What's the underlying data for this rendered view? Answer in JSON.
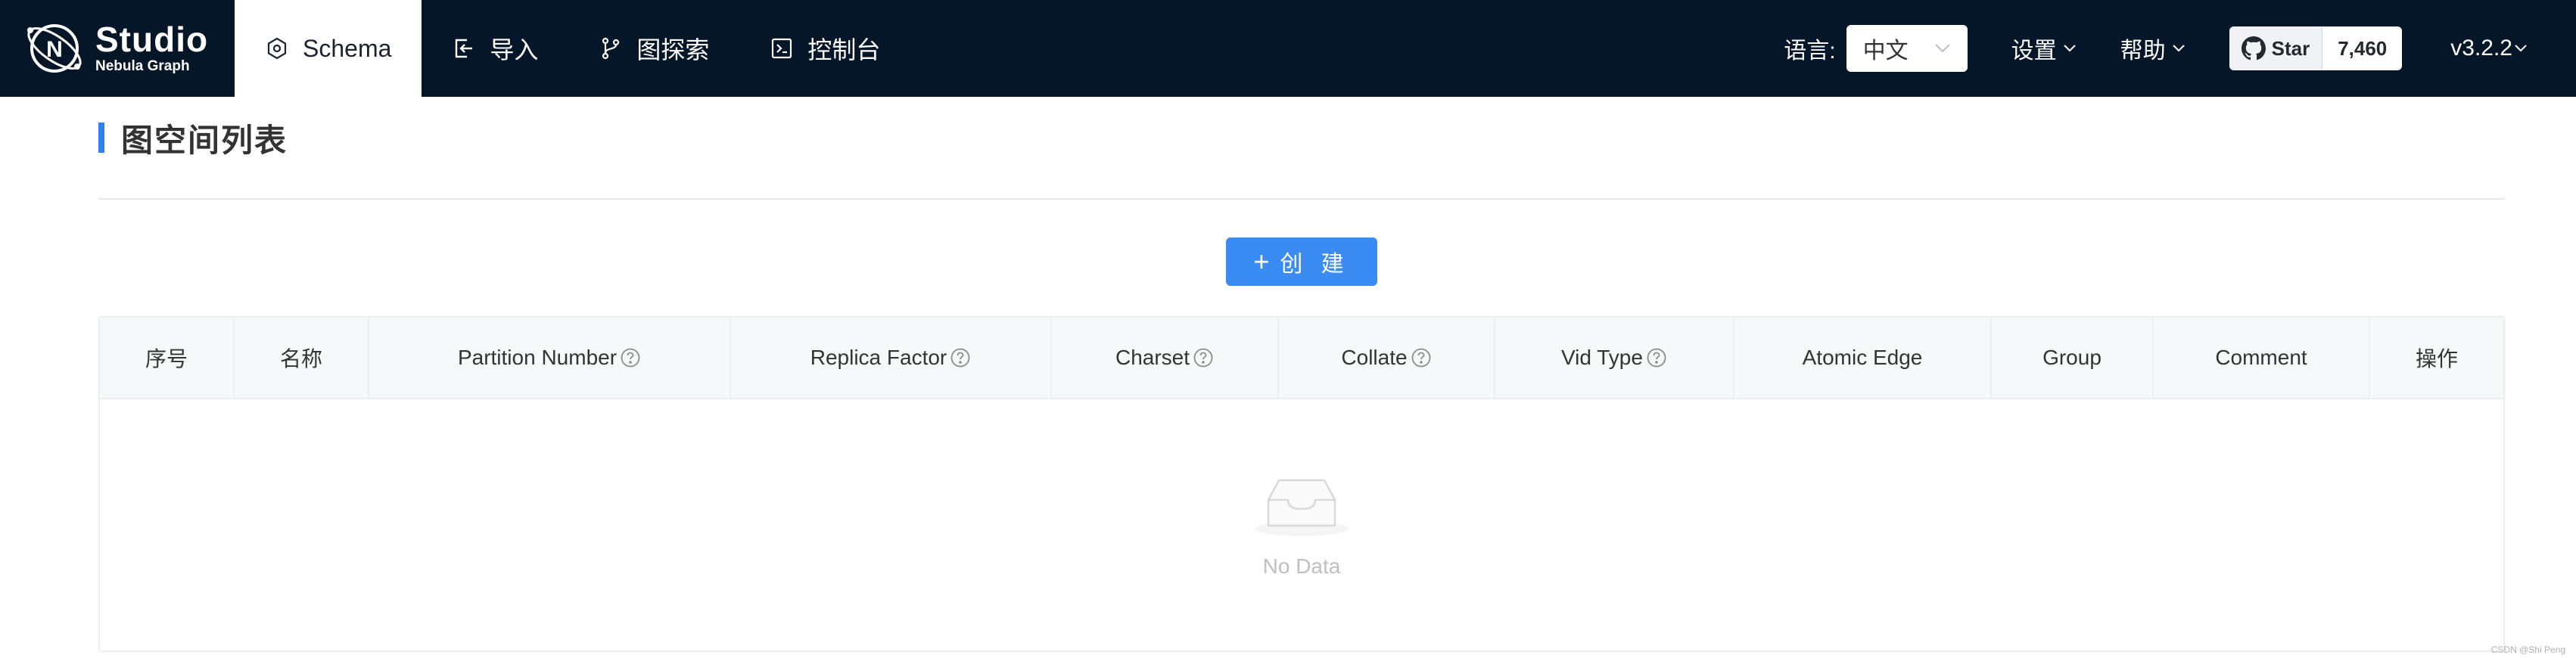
{
  "brand": {
    "title": "Studio",
    "subtitle": "Nebula Graph",
    "logo_letter": "N"
  },
  "nav": {
    "items": [
      {
        "label": "Schema",
        "icon": "schema-icon",
        "active": true
      },
      {
        "label": "导入",
        "icon": "import-icon",
        "active": false
      },
      {
        "label": "图探索",
        "icon": "explore-icon",
        "active": false
      },
      {
        "label": "控制台",
        "icon": "console-icon",
        "active": false
      }
    ]
  },
  "header": {
    "language_label": "语言:",
    "language_value": "中文",
    "settings_label": "设置",
    "help_label": "帮助",
    "github_star_label": "Star",
    "github_star_count": "7,460",
    "version": "v3.2.2"
  },
  "page": {
    "title": "图空间列表",
    "create_button": "创 建"
  },
  "table": {
    "columns": [
      {
        "label": "序号",
        "help": false
      },
      {
        "label": "名称",
        "help": false
      },
      {
        "label": "Partition Number",
        "help": true
      },
      {
        "label": "Replica Factor",
        "help": true
      },
      {
        "label": "Charset",
        "help": true
      },
      {
        "label": "Collate",
        "help": true
      },
      {
        "label": "Vid Type",
        "help": true
      },
      {
        "label": "Atomic Edge",
        "help": false
      },
      {
        "label": "Group",
        "help": false
      },
      {
        "label": "Comment",
        "help": false
      },
      {
        "label": "操作",
        "help": false
      }
    ],
    "empty_text": "No Data"
  },
  "watermark": "CSDN @Shi Peng",
  "colors": {
    "topbar": "#061629",
    "accent": "#3b8cf2",
    "title_bar": "#2f80ed"
  }
}
